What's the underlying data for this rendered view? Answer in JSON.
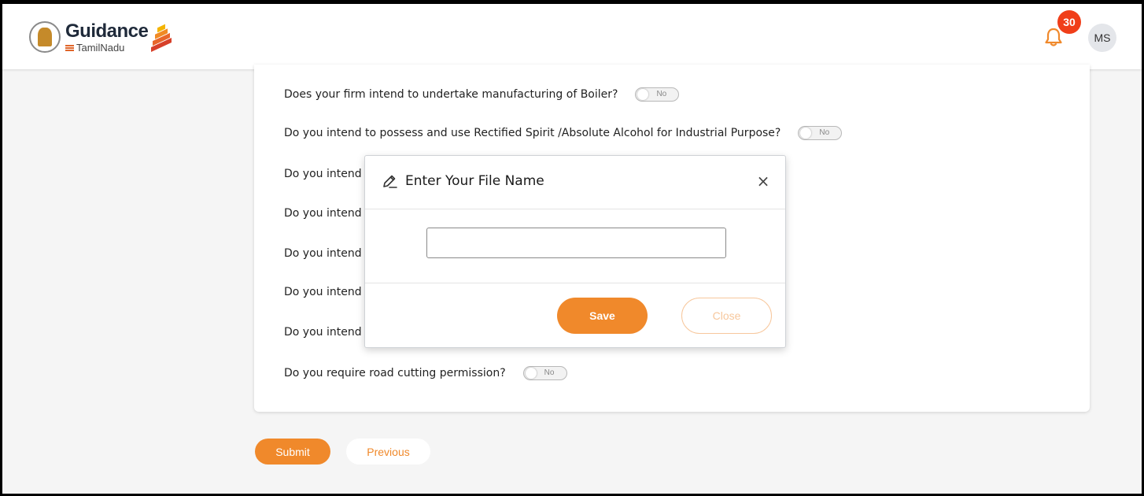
{
  "header": {
    "brand_main": "Guidance",
    "brand_sub": "TamilNadu",
    "notification_count": "30",
    "avatar_initials": "MS",
    "accent_color": "#f0892b",
    "badge_color": "#f03e19"
  },
  "form": {
    "questions": [
      {
        "text": "Does your firm intend to undertake manufacturing of Boiler?",
        "toggle": "No"
      },
      {
        "text": "Do you intend to possess and use Rectified Spirit /Absolute Alcohol for Industrial Purpose?",
        "toggle": "No"
      },
      {
        "text": "Do you intend",
        "toggle": ""
      },
      {
        "text": "Do you intend",
        "toggle": ""
      },
      {
        "text": "Do you intend",
        "toggle": ""
      },
      {
        "text": "Do you intend",
        "toggle": ""
      },
      {
        "text": "Do you intend",
        "toggle": ""
      },
      {
        "text": "Do you require road cutting permission?",
        "toggle": "No"
      }
    ],
    "submit_label": "Submit",
    "previous_label": "Previous"
  },
  "modal": {
    "title": "Enter Your File Name",
    "close_icon": "×",
    "input_value": "",
    "save_label": "Save",
    "close_label": "Close"
  },
  "icons": {
    "bell": "bell-icon",
    "pen": "pen-icon",
    "close": "close-icon"
  }
}
